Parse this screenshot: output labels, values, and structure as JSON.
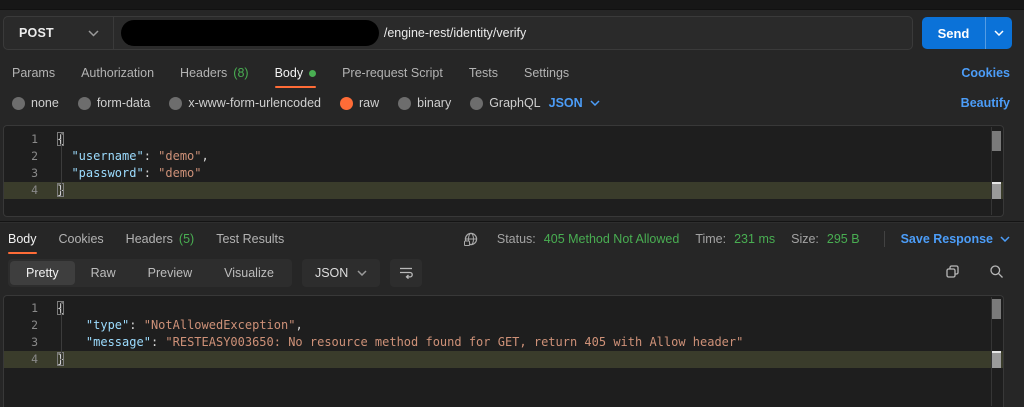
{
  "topbar": {
    "method": "POST",
    "url_visible_path": "/engine-rest/identity/verify",
    "send_label": "Send"
  },
  "request_tabs": {
    "items": [
      {
        "label": "Params"
      },
      {
        "label": "Authorization"
      },
      {
        "label": "Headers",
        "count": "(8)"
      },
      {
        "label": "Body",
        "active": true,
        "dot": true
      },
      {
        "label": "Pre-request Script"
      },
      {
        "label": "Tests"
      },
      {
        "label": "Settings"
      }
    ],
    "cookies_link": "Cookies"
  },
  "body_mode_bar": {
    "options": [
      {
        "label": "none"
      },
      {
        "label": "form-data"
      },
      {
        "label": "x-www-form-urlencoded"
      },
      {
        "label": "raw",
        "selected": true
      },
      {
        "label": "binary"
      },
      {
        "label": "GraphQL"
      }
    ],
    "language": "JSON",
    "beautify_link": "Beautify"
  },
  "request_editor": {
    "lines": [
      {
        "num": "1",
        "tokens": [
          {
            "c": "brace match",
            "t": "{"
          }
        ]
      },
      {
        "num": "2",
        "tokens": [
          {
            "c": "plain",
            "t": "  "
          },
          {
            "c": "key",
            "t": "\"username\""
          },
          {
            "c": "plain",
            "t": ": "
          },
          {
            "c": "str",
            "t": "\"demo\""
          },
          {
            "c": "plain",
            "t": ","
          }
        ]
      },
      {
        "num": "3",
        "tokens": [
          {
            "c": "plain",
            "t": "  "
          },
          {
            "c": "key",
            "t": "\"password\""
          },
          {
            "c": "plain",
            "t": ": "
          },
          {
            "c": "str",
            "t": "\"demo\""
          }
        ]
      },
      {
        "num": "4",
        "highlight": true,
        "tokens": [
          {
            "c": "brace match",
            "t": "}"
          }
        ]
      }
    ]
  },
  "response_meta": {
    "tabs": [
      {
        "label": "Body",
        "active": true
      },
      {
        "label": "Cookies"
      },
      {
        "label": "Headers",
        "count": "(5)"
      },
      {
        "label": "Test Results"
      }
    ],
    "status_label": "Status:",
    "status_value": "405 Method Not Allowed",
    "time_label": "Time:",
    "time_value": "231 ms",
    "size_label": "Size:",
    "size_value": "295 B",
    "save_response_label": "Save Response"
  },
  "response_toolbar": {
    "views": [
      {
        "label": "Pretty",
        "active": true
      },
      {
        "label": "Raw"
      },
      {
        "label": "Preview"
      },
      {
        "label": "Visualize"
      }
    ],
    "language": "JSON"
  },
  "response_editor": {
    "lines": [
      {
        "num": "1",
        "tokens": [
          {
            "c": "brace match",
            "t": "{"
          }
        ]
      },
      {
        "num": "2",
        "tokens": [
          {
            "c": "plain",
            "t": "    "
          },
          {
            "c": "key",
            "t": "\"type\""
          },
          {
            "c": "plain",
            "t": ": "
          },
          {
            "c": "str",
            "t": "\"NotAllowedException\""
          },
          {
            "c": "plain",
            "t": ","
          }
        ]
      },
      {
        "num": "3",
        "tokens": [
          {
            "c": "plain",
            "t": "    "
          },
          {
            "c": "key",
            "t": "\"message\""
          },
          {
            "c": "plain",
            "t": ": "
          },
          {
            "c": "str",
            "t": "\"RESTEASY003650: No resource method found for GET, return 405 with Allow header\""
          }
        ]
      },
      {
        "num": "4",
        "highlight": true,
        "tokens": [
          {
            "c": "brace match",
            "t": "}"
          }
        ]
      }
    ]
  },
  "colors": {
    "accent_orange": "#ff6c37",
    "status_green": "#49ae52",
    "link_blue": "#4c9df8",
    "send_blue": "#0b72d8"
  }
}
